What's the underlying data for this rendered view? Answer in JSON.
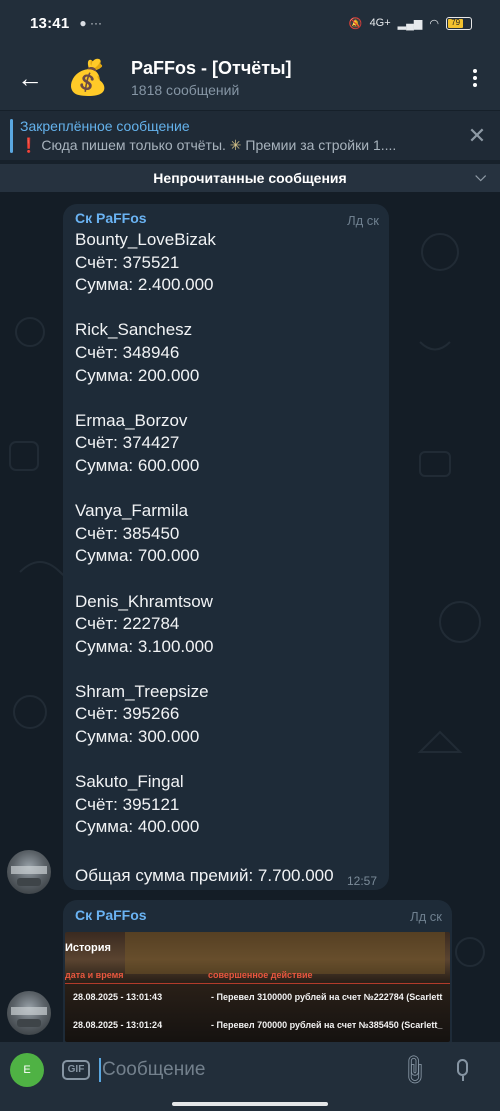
{
  "status": {
    "time": "13:41",
    "network": "4G+",
    "battery": "79"
  },
  "header": {
    "title": "PaFFos - [Отчёты]",
    "subtitle": "1818 сообщений",
    "avatar_emoji": "💰"
  },
  "pinned": {
    "title": "Закреплённое сообщение",
    "text_mark": "❗",
    "text_part1": "Сюда пишем только отчёты.",
    "text_icon": "✳",
    "text_part2": "Премии за стройки",
    "text_ellipsis": "1...."
  },
  "unread_label": "Непрочитанные сообщения",
  "message1": {
    "sender": "Ск PaFFos",
    "badge": "Лд ск",
    "entries": [
      {
        "name": "Bounty_LoveBizak",
        "account": "Счёт: 375521",
        "sum": "Сумма: 2.400.000"
      },
      {
        "name": "Rick_Sanchesz",
        "account": "Счёт: 348946",
        "sum": "Сумма: 200.000"
      },
      {
        "name": "Ermaa_Borzov",
        "account": "Счёт: 374427",
        "sum": "Сумма: 600.000"
      },
      {
        "name": "Vanya_Farmila",
        "account": "Счёт: 385450",
        "sum": "Сумма: 700.000"
      },
      {
        "name": "Denis_Khramtsow",
        "account": "Счёт: 222784",
        "sum": "Сумма: 3.100.000"
      },
      {
        "name": "Shram_Treepsize",
        "account": "Счёт: 395266",
        "sum": "Сумма: 300.000"
      },
      {
        "name": "Sakuto_Fingal",
        "account": "Счёт: 395121",
        "sum": "Сумма: 400.000"
      }
    ],
    "total": "Общая сумма премий: 7.700.000",
    "time": "12:57"
  },
  "message2": {
    "sender": "Ск PaFFos",
    "badge": "Лд ск",
    "image": {
      "heading": "История",
      "col_date": "дата и время",
      "col_action": "совершенное действие",
      "rows": [
        {
          "date": "28.08.2025 - 13:01:43",
          "action": "- Перевел 3100000 рублей на счет №222784 (Scarlett"
        },
        {
          "date": "28.08.2025 - 13:01:24",
          "action": "- Перевел 700000 рублей на счет №385450 (Scarlett_"
        }
      ]
    }
  },
  "input": {
    "user_initial": "E",
    "gif_label": "GIF",
    "placeholder": "Сообщение"
  },
  "colors": {
    "accent": "#6ab3f3",
    "bubble": "#1e2b38",
    "background": "#141d26",
    "header": "#222e3a"
  }
}
